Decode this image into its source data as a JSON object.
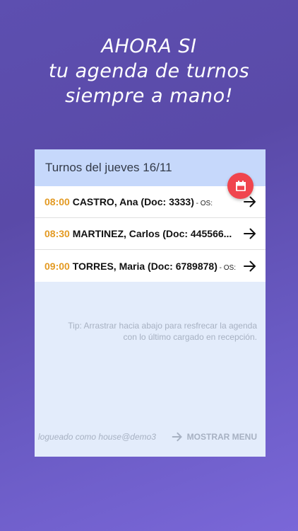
{
  "hero": {
    "line1": "AHORA SI",
    "line2": "tu agenda de turnos",
    "line3": "siempre a mano!"
  },
  "header": {
    "title": "Turnos del jueves 16/11"
  },
  "appointments": [
    {
      "time": "08:00",
      "patient": "CASTRO, Ana (Doc: 3333)",
      "os": " - OS:"
    },
    {
      "time": "08:30",
      "patient": "MARTINEZ, Carlos (Doc: 445566...",
      "os": ""
    },
    {
      "time": "09:00",
      "patient": "TORRES, Maria (Doc: 6789878)",
      "os": " - OS:"
    }
  ],
  "tip": "Tip: Arrastrar hacia abajo para resfrecar la agenda con lo último cargado en recepción.",
  "footer": {
    "logged_as": "logueado como house@demo3",
    "menu_label": "MOSTRAR MENU"
  },
  "colors": {
    "accent_time": "#e39a23",
    "fab": "#f0454e",
    "header_bg": "#c6d8fb"
  },
  "icons": {
    "fab": "calendar-icon",
    "row": "arrow-right-icon",
    "menu": "arrow-right-icon"
  }
}
